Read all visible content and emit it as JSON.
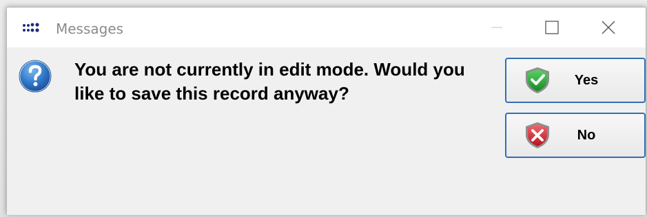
{
  "window": {
    "title": "Messages",
    "icon": "app-dots-icon",
    "controls": {
      "minimize": "minimize-icon",
      "maximize": "maximize-icon",
      "close": "close-icon"
    }
  },
  "message": {
    "icon": "question-icon",
    "text": "You are not currently in edit mode. Would you like to save this record anyway?"
  },
  "buttons": {
    "yes": {
      "label": "Yes",
      "icon": "green-check-shield-icon",
      "color": "#1fa22e"
    },
    "no": {
      "label": "No",
      "icon": "red-x-shield-icon",
      "color": "#d01f2a"
    }
  },
  "colors": {
    "accent_border": "#2f6fb3",
    "question_blue": "#2f78c8"
  }
}
